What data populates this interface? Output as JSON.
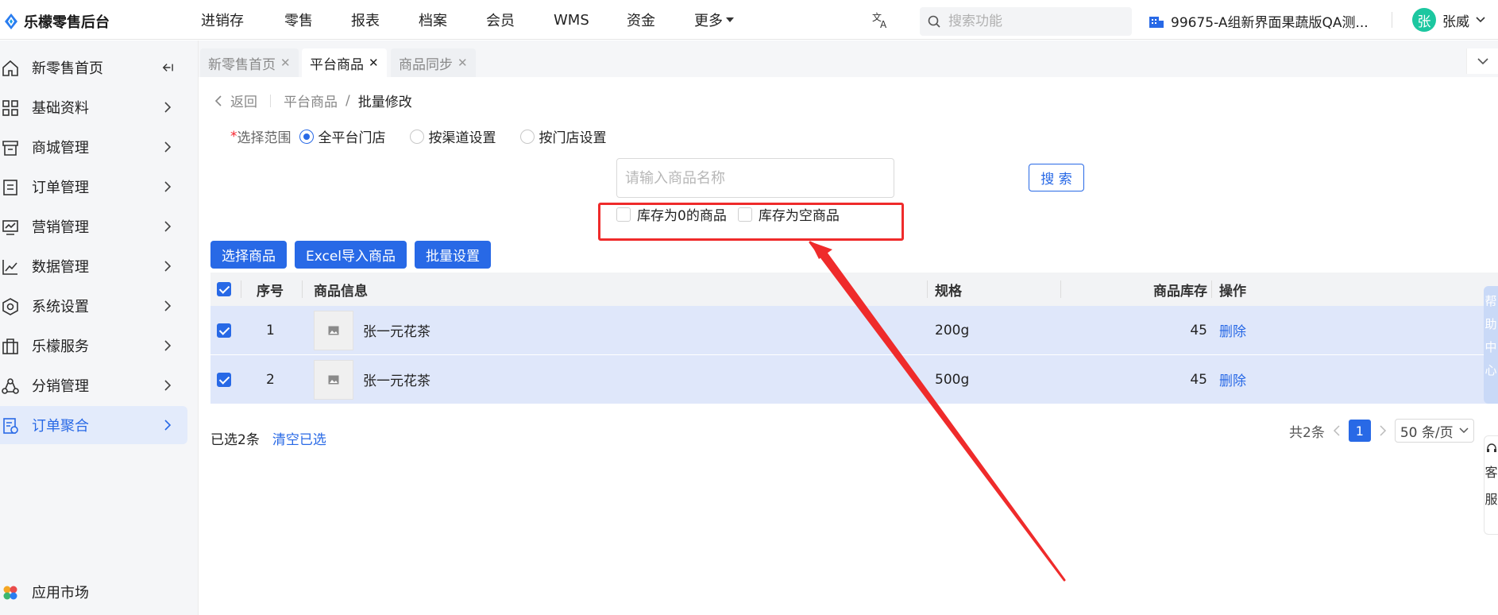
{
  "app": {
    "name": "乐檬零售后台",
    "brand_color": "#2869e6"
  },
  "topnav": [
    "进销存",
    "零售",
    "报表",
    "档案",
    "会员",
    "WMS",
    "资金",
    "更多"
  ],
  "search": {
    "placeholder": "搜索功能"
  },
  "store": {
    "name": "99675-A组新界面果蔬版QA测..."
  },
  "user": {
    "avatar_char": "张",
    "name": "张威"
  },
  "sidebar": {
    "items": [
      {
        "label": "新零售首页",
        "icon": "home-icon"
      },
      {
        "label": "基础资料",
        "icon": "grid-icon"
      },
      {
        "label": "商城管理",
        "icon": "store-icon"
      },
      {
        "label": "订单管理",
        "icon": "order-icon"
      },
      {
        "label": "营销管理",
        "icon": "marketing-icon"
      },
      {
        "label": "数据管理",
        "icon": "chart-line-icon"
      },
      {
        "label": "系统设置",
        "icon": "settings-icon"
      },
      {
        "label": "乐檬服务",
        "icon": "briefcase-icon"
      },
      {
        "label": "分销管理",
        "icon": "distribution-icon"
      },
      {
        "label": "订单聚合",
        "icon": "aggregate-icon",
        "active": true
      }
    ],
    "bottom": {
      "label": "应用市场",
      "icon": "app-market-icon"
    }
  },
  "tabs": [
    {
      "label": "新零售首页",
      "close": "✕"
    },
    {
      "label": "平台商品",
      "close": "✕",
      "active": true
    },
    {
      "label": "商品同步",
      "close": "✕"
    }
  ],
  "breadcrumb": {
    "back": "返回",
    "parent": "平台商品",
    "sep": "/",
    "current": "批量修改"
  },
  "range": {
    "required_mark": "*",
    "label": "选择范围",
    "options": [
      "全平台门店",
      "按渠道设置",
      "按门店设置"
    ],
    "selected": "全平台门店"
  },
  "product_search": {
    "placeholder": "请输入商品名称",
    "button": "搜 索"
  },
  "filters": [
    {
      "label": "库存为0的商品",
      "checked": false
    },
    {
      "label": "库存为空商品",
      "checked": false
    }
  ],
  "action_buttons": [
    "选择商品",
    "Excel导入商品",
    "批量设置"
  ],
  "table": {
    "headers": {
      "index": "序号",
      "info": "商品信息",
      "spec": "规格",
      "stock": "商品库存",
      "op": "操作"
    },
    "rows": [
      {
        "index": "1",
        "name": "张一元花茶",
        "spec": "200g",
        "stock": "45",
        "op": "删除",
        "checked": true
      },
      {
        "index": "2",
        "name": "张一元花茶",
        "spec": "500g",
        "stock": "45",
        "op": "删除",
        "checked": true
      }
    ]
  },
  "footer": {
    "selected": "已选2条",
    "clear": "清空已选"
  },
  "pagination": {
    "total": "共2条",
    "page": "1",
    "page_size": "50 条/页"
  },
  "help_panel": {
    "label": "帮助中心",
    "chars": [
      "帮",
      "助",
      "中",
      "心"
    ]
  },
  "service_panel": {
    "chars": [
      "客",
      "服"
    ]
  },
  "annotation": {
    "color": "#ef2b2b"
  }
}
